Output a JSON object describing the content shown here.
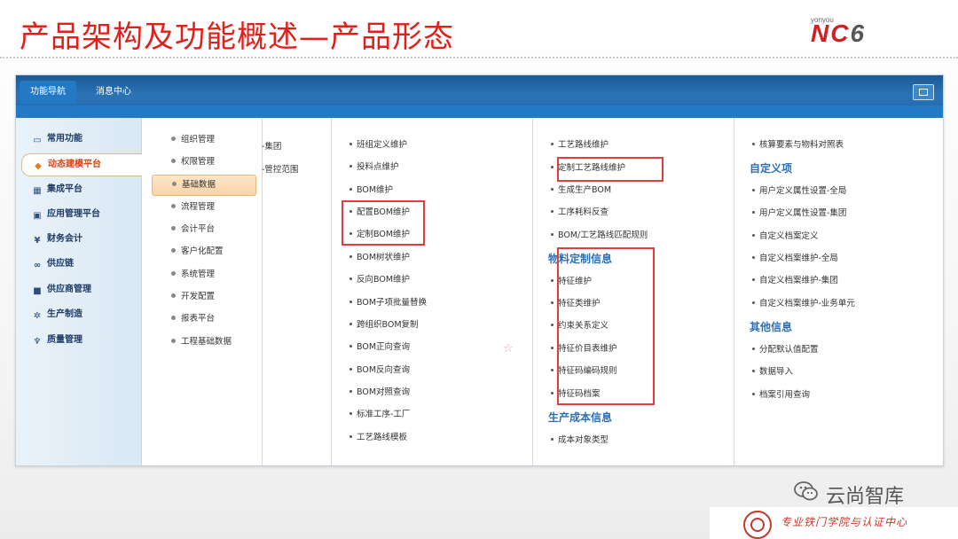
{
  "slide_title": "产品架构及功能概述—产品形态",
  "logo": {
    "small": "yonyou",
    "big": "NC",
    "num": "6"
  },
  "window": {
    "tabs": [
      {
        "label": "功能导航"
      },
      {
        "label": "消息中心"
      }
    ]
  },
  "sidebar": {
    "items": [
      {
        "label": "常用功能",
        "icon": "monitor-icon"
      },
      {
        "label": "动态建模平台",
        "icon": "cube-icon"
      },
      {
        "label": "集成平台",
        "icon": "grid-icon"
      },
      {
        "label": "应用管理平台",
        "icon": "app-icon"
      },
      {
        "label": "财务会计",
        "icon": "yen-icon"
      },
      {
        "label": "供应链",
        "icon": "link-icon"
      },
      {
        "label": "供应商管理",
        "icon": "box-icon"
      },
      {
        "label": "生产制造",
        "icon": "gear-icon"
      },
      {
        "label": "质量管理",
        "icon": "network-icon"
      }
    ]
  },
  "submenu": {
    "items": [
      {
        "label": "组织管理"
      },
      {
        "label": "权限管理"
      },
      {
        "label": "基础数据"
      },
      {
        "label": "流程管理"
      },
      {
        "label": "会计平台"
      },
      {
        "label": "客户化配置"
      },
      {
        "label": "系统管理"
      },
      {
        "label": "开发配置"
      },
      {
        "label": "报表平台"
      },
      {
        "label": "工程基础数据"
      }
    ]
  },
  "scope": {
    "items": [
      {
        "label": "-集团"
      },
      {
        "label": "-管控范围"
      }
    ]
  },
  "col_a": {
    "items": [
      {
        "label": "班组定义维护"
      },
      {
        "label": "投料点维护"
      },
      {
        "label": "BOM维护"
      },
      {
        "label": "配置BOM维护"
      },
      {
        "label": "定制BOM维护"
      },
      {
        "label": "BOM树状维护"
      },
      {
        "label": "反向BOM维护"
      },
      {
        "label": "BOM子项批量替换"
      },
      {
        "label": "跨组织BOM复制"
      },
      {
        "label": "BOM正向查询"
      },
      {
        "label": "BOM反向查询"
      },
      {
        "label": "BOM对照查询"
      },
      {
        "label": "标准工序-工厂"
      },
      {
        "label": "工艺路线模板"
      }
    ]
  },
  "col_b": {
    "items_top": [
      {
        "label": "工艺路线维护"
      },
      {
        "label": "定制工艺路线维护"
      },
      {
        "label": "生成生产BOM"
      },
      {
        "label": "工序耗料反查"
      },
      {
        "label": "BOM/工艺路线匹配规则"
      }
    ],
    "section1": {
      "title": "物料定制信息",
      "items": [
        {
          "label": "特征维护"
        },
        {
          "label": "特征类维护"
        },
        {
          "label": "约束关系定义"
        },
        {
          "label": "特征价目表维护"
        },
        {
          "label": "特征码编码规则"
        },
        {
          "label": "特征码档案"
        }
      ]
    },
    "section2": {
      "title": "生产成本信息",
      "items": [
        {
          "label": "成本对象类型"
        }
      ]
    }
  },
  "col_c": {
    "items_top": [
      {
        "label": "核算要素与物料对照表"
      }
    ],
    "section1": {
      "title": "自定义项",
      "items": [
        {
          "label": "用户定义属性设置-全局"
        },
        {
          "label": "用户定义属性设置-集团"
        },
        {
          "label": "自定义档案定义"
        },
        {
          "label": "自定义档案维护-全局"
        },
        {
          "label": "自定义档案维护-集团"
        },
        {
          "label": "自定义档案维护-业务单元"
        }
      ]
    },
    "section2": {
      "title": "其他信息",
      "items": [
        {
          "label": "分配默认值配置"
        },
        {
          "label": "数据导入"
        },
        {
          "label": "档案引用查询"
        }
      ]
    }
  },
  "watermark": {
    "text": "云尚智库",
    "script": "专业铁门学院与认证中心"
  },
  "colors": {
    "title_red": "#e0201a",
    "nav_blue": "#2379c4",
    "highlight_red": "#e33c3c",
    "section_blue": "#2a6fb8"
  }
}
